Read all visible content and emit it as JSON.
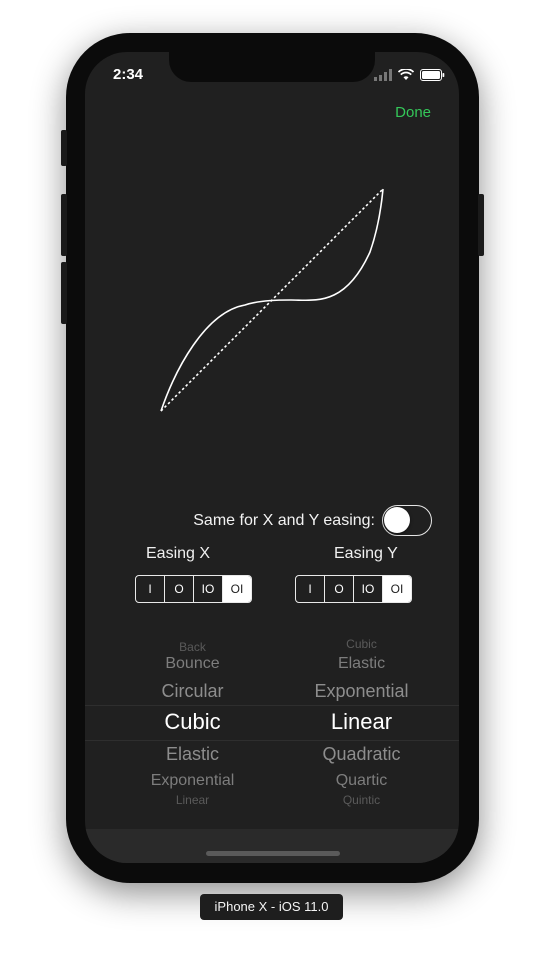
{
  "status": {
    "time": "2:34"
  },
  "nav": {
    "done_label": "Done"
  },
  "same_easing": {
    "label": "Same for X and Y easing:",
    "enabled": false
  },
  "easing_x": {
    "title": "Easing X",
    "modes": [
      "I",
      "O",
      "IO",
      "OI"
    ],
    "selected_mode": "OI",
    "picker": {
      "items": [
        "Back",
        "Bounce",
        "Circular",
        "Cubic",
        "Elastic",
        "Exponential",
        "Linear"
      ],
      "selected": "Cubic"
    }
  },
  "easing_y": {
    "title": "Easing Y",
    "modes": [
      "I",
      "O",
      "IO",
      "OI"
    ],
    "selected_mode": "OI",
    "picker": {
      "items": [
        "Cubic",
        "Elastic",
        "Exponential",
        "Linear",
        "Quadratic",
        "Quartic",
        "Quintic"
      ],
      "selected": "Linear"
    }
  },
  "device_label": "iPhone X - iOS 11.0",
  "colors": {
    "accent": "#34c759",
    "background": "#202020"
  },
  "icons": [
    "signal-icon",
    "wifi-icon",
    "battery-icon"
  ]
}
